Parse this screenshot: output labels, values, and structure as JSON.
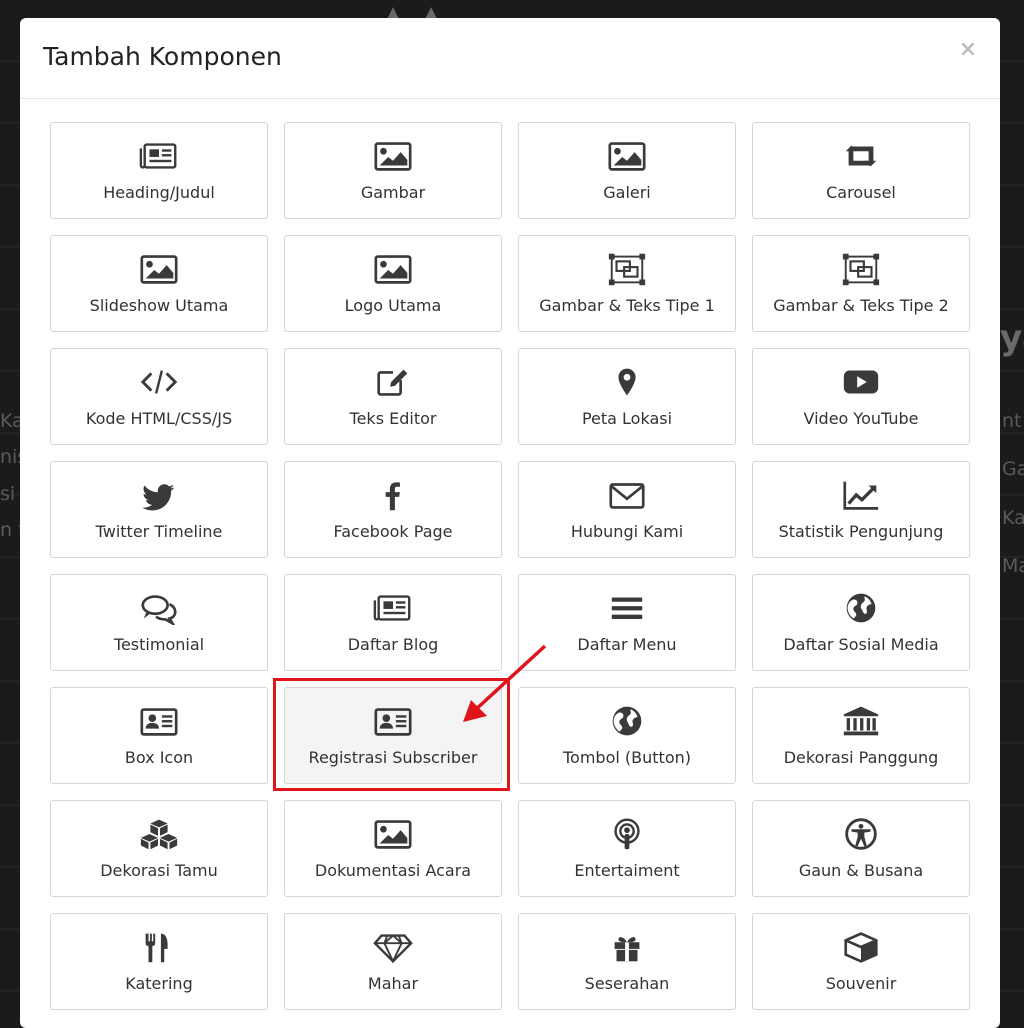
{
  "modal": {
    "title": "Tambah Komponen",
    "close_symbol": "×"
  },
  "background_text": [
    "Kar",
    "nis",
    "si d",
    "n t",
    "nt",
    "Ga",
    "Ka",
    "Ma",
    "ya"
  ],
  "components": [
    {
      "label": "Heading/Judul",
      "icon": "newspaper-icon"
    },
    {
      "label": "Gambar",
      "icon": "image-icon"
    },
    {
      "label": "Galeri",
      "icon": "image-icon"
    },
    {
      "label": "Carousel",
      "icon": "retweet-icon"
    },
    {
      "label": "Slideshow Utama",
      "icon": "image-icon"
    },
    {
      "label": "Logo Utama",
      "icon": "image-icon"
    },
    {
      "label": "Gambar & Teks Tipe 1",
      "icon": "object-group-icon"
    },
    {
      "label": "Gambar & Teks Tipe 2",
      "icon": "object-group-icon"
    },
    {
      "label": "Kode HTML/CSS/JS",
      "icon": "code-icon"
    },
    {
      "label": "Teks Editor",
      "icon": "edit-icon"
    },
    {
      "label": "Peta Lokasi",
      "icon": "map-marker-icon"
    },
    {
      "label": "Video YouTube",
      "icon": "youtube-icon"
    },
    {
      "label": "Twitter Timeline",
      "icon": "twitter-icon"
    },
    {
      "label": "Facebook Page",
      "icon": "facebook-icon"
    },
    {
      "label": "Hubungi Kami",
      "icon": "envelope-icon"
    },
    {
      "label": "Statistik Pengunjung",
      "icon": "line-chart-icon"
    },
    {
      "label": "Testimonial",
      "icon": "comments-icon"
    },
    {
      "label": "Daftar Blog",
      "icon": "newspaper-icon"
    },
    {
      "label": "Daftar Menu",
      "icon": "bars-icon"
    },
    {
      "label": "Daftar Sosial Media",
      "icon": "globe-icon"
    },
    {
      "label": "Box Icon",
      "icon": "address-card-icon"
    },
    {
      "label": "Registrasi Subscriber",
      "icon": "address-card-icon",
      "highlighted": true
    },
    {
      "label": "Tombol (Button)",
      "icon": "globe-icon"
    },
    {
      "label": "Dekorasi Panggung",
      "icon": "bank-icon"
    },
    {
      "label": "Dekorasi Tamu",
      "icon": "cubes-icon"
    },
    {
      "label": "Dokumentasi Acara",
      "icon": "image-icon"
    },
    {
      "label": "Entertaiment",
      "icon": "podcast-icon"
    },
    {
      "label": "Gaun & Busana",
      "icon": "universal-access-icon"
    },
    {
      "label": "Katering",
      "icon": "cutlery-icon"
    },
    {
      "label": "Mahar",
      "icon": "diamond-icon"
    },
    {
      "label": "Seserahan",
      "icon": "gift-icon"
    },
    {
      "label": "Souvenir",
      "icon": "cube-icon"
    }
  ],
  "colors": {
    "highlight": "#e0151b",
    "icon": "#3a3a3a",
    "backdrop": "#1b1b1b"
  }
}
